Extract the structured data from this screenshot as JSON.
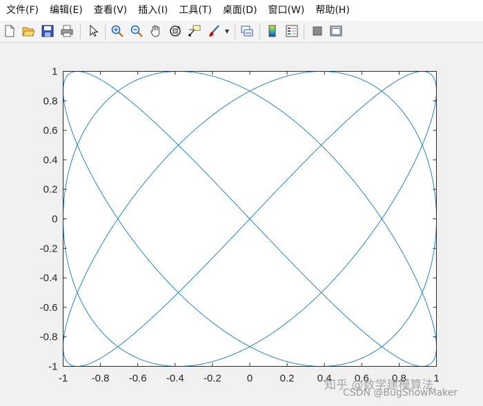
{
  "menu": {
    "items": [
      "文件(F)",
      "编辑(E)",
      "查看(V)",
      "插入(I)",
      "工具(T)",
      "桌面(D)",
      "窗口(W)",
      "帮助(H)"
    ]
  },
  "toolbar": {
    "icons": [
      "new-figure-icon",
      "open-file-icon",
      "save-icon",
      "print-icon",
      "pointer-icon",
      "zoom-in-icon",
      "zoom-out-icon",
      "pan-hand-icon",
      "rotate-3d-icon",
      "data-cursor-icon",
      "brush-icon",
      "link-plot-icon",
      "colorbar-icon",
      "legend-icon",
      "hide-plot-tools-icon",
      "show-plot-tools-icon"
    ]
  },
  "colors": {
    "line": "#0072bd",
    "axes_background": "#ffffff",
    "figure_background": "#f0f0f0"
  },
  "chart_data": {
    "type": "line",
    "title": "",
    "xlabel": "",
    "ylabel": "",
    "xlim": [
      -1,
      1
    ],
    "ylim": [
      -1,
      1
    ],
    "grid": false,
    "x_ticks": [
      "-1",
      "-0.8",
      "-0.6",
      "-0.4",
      "-0.2",
      "0",
      "0.2",
      "0.4",
      "0.6",
      "0.8",
      "1"
    ],
    "y_ticks": [
      "1",
      "0.8",
      "0.6",
      "0.4",
      "0.2",
      "0",
      "-0.2",
      "-0.4",
      "-0.6",
      "-0.8",
      "-1"
    ],
    "series": [
      {
        "curve": "lissajous",
        "x_equation": "sin(3t + pi/4)",
        "y_equation": "sin(4t)",
        "t_range": [
          0,
          6.2832
        ]
      }
    ]
  },
  "watermark": {
    "line1": "知乎 @数学建模算法",
    "line2": "CSDN @BugShowMaker"
  }
}
